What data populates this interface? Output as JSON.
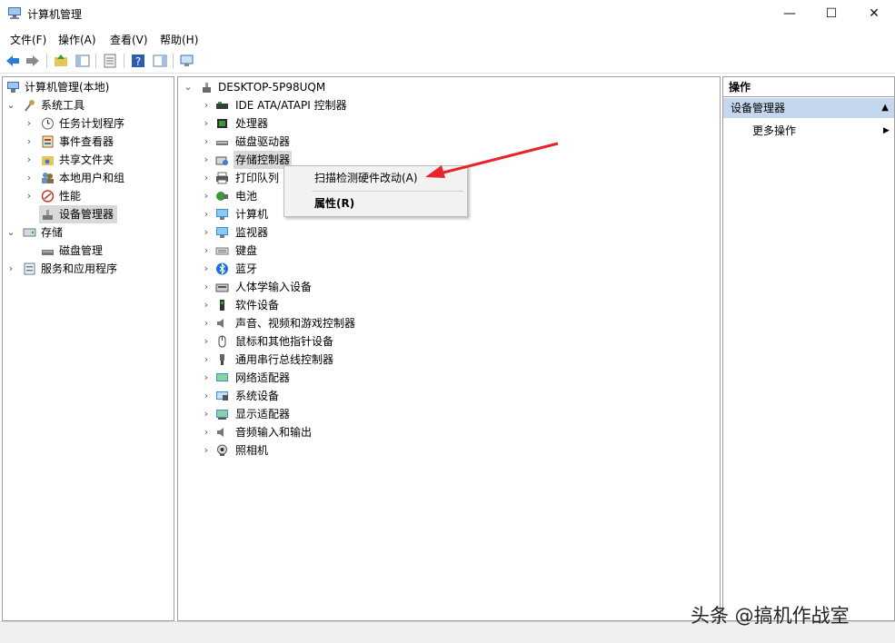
{
  "window": {
    "title": "计算机管理",
    "minimize": "—",
    "maximize": "☐",
    "close": "✕"
  },
  "menu": [
    "文件(F)",
    "操作(A)",
    "查看(V)",
    "帮助(H)"
  ],
  "left_tree": {
    "root": "计算机管理(本地)",
    "system_tools": "系统工具",
    "task_scheduler": "任务计划程序",
    "event_viewer": "事件查看器",
    "shared_folders": "共享文件夹",
    "local_users": "本地用户和组",
    "performance": "性能",
    "device_manager": "设备管理器",
    "storage": "存储",
    "disk_management": "磁盘管理",
    "services_apps": "服务和应用程序"
  },
  "device_tree": {
    "computer": "DESKTOP-5P98UQM",
    "categories": [
      {
        "label": "IDE ATA/ATAPI 控制器",
        "icon": "ide-controller-icon"
      },
      {
        "label": "处理器",
        "icon": "processor-icon"
      },
      {
        "label": "磁盘驱动器",
        "icon": "disk-drive-icon"
      },
      {
        "label": "存储控制器",
        "icon": "storage-controller-icon"
      },
      {
        "label": "打印队列",
        "icon": "printer-icon"
      },
      {
        "label": "电池",
        "icon": "battery-icon"
      },
      {
        "label": "计算机",
        "icon": "computer-icon"
      },
      {
        "label": "监视器",
        "icon": "monitor-icon"
      },
      {
        "label": "键盘",
        "icon": "keyboard-icon"
      },
      {
        "label": "蓝牙",
        "icon": "bluetooth-icon"
      },
      {
        "label": "人体学输入设备",
        "icon": "hid-icon"
      },
      {
        "label": "软件设备",
        "icon": "software-device-icon"
      },
      {
        "label": "声音、视频和游戏控制器",
        "icon": "sound-icon"
      },
      {
        "label": "鼠标和其他指针设备",
        "icon": "mouse-icon"
      },
      {
        "label": "通用串行总线控制器",
        "icon": "usb-icon"
      },
      {
        "label": "网络适配器",
        "icon": "network-adapter-icon"
      },
      {
        "label": "系统设备",
        "icon": "system-device-icon"
      },
      {
        "label": "显示适配器",
        "icon": "display-adapter-icon"
      },
      {
        "label": "音频输入和输出",
        "icon": "audio-io-icon"
      },
      {
        "label": "照相机",
        "icon": "camera-icon"
      }
    ]
  },
  "context_menu": {
    "scan": "扫描检测硬件改动(A)",
    "properties": "属性(R)"
  },
  "actions_panel": {
    "header": "操作",
    "section": "设备管理器",
    "more": "更多操作"
  },
  "watermark": "头条 @搞机作战室",
  "colors": {
    "selection": "#d9d9d9",
    "actions_section": "#c5d7ee",
    "annotation_arrow": "#e8242a"
  }
}
